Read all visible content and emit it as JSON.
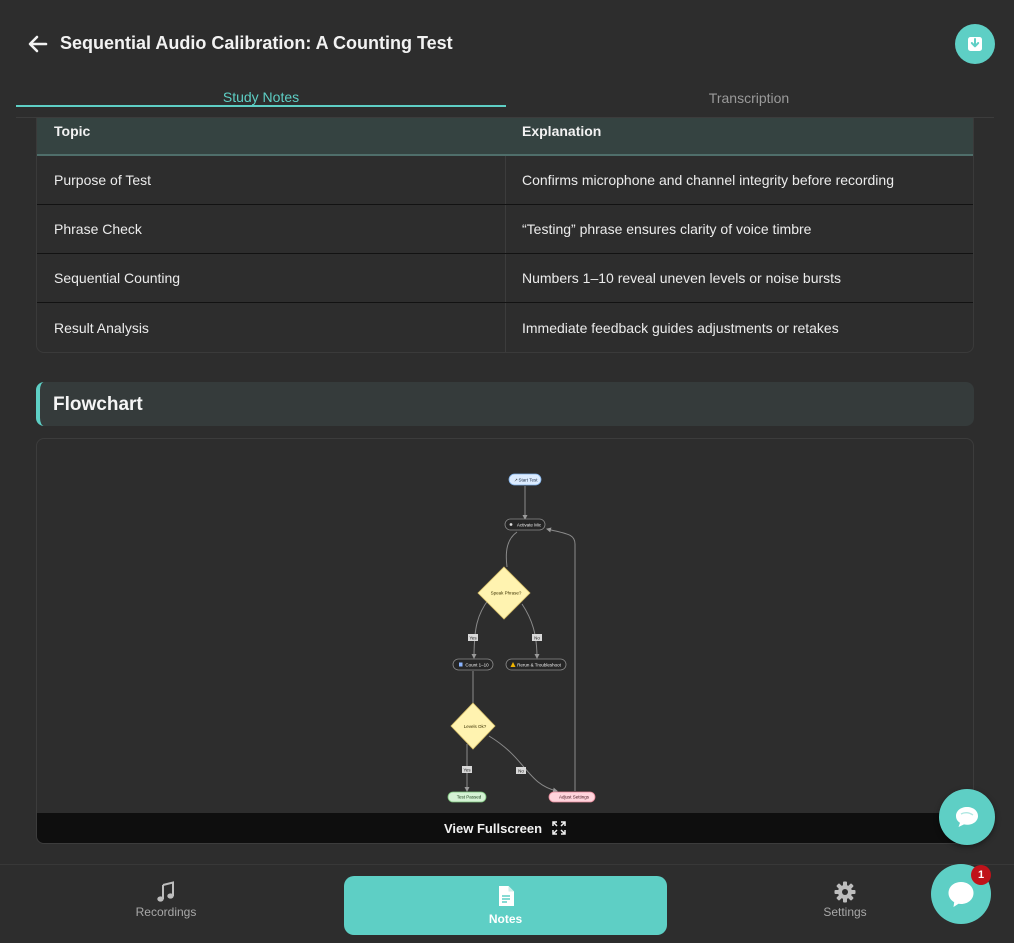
{
  "header": {
    "title": "Sequential Audio Calibration: A Counting Test",
    "back_icon": "arrow-left-icon",
    "download_icon": "download-icon",
    "accent_color": "#5ecfc5"
  },
  "tabs": [
    {
      "label": "Study Notes",
      "active": true
    },
    {
      "label": "Transcription",
      "active": false
    }
  ],
  "table": {
    "headers": [
      "Topic",
      "Explanation"
    ],
    "rows": [
      [
        "Purpose of Test",
        "Confirms microphone and channel integrity before recording"
      ],
      [
        "Phrase Check",
        "“Testing” phrase ensures clarity of voice timbre"
      ],
      [
        "Sequential Counting",
        "Numbers 1–10 reveal uneven levels or noise bursts"
      ],
      [
        "Result Analysis",
        "Immediate feedback guides adjustments or retakes"
      ]
    ]
  },
  "flowchart": {
    "title": "Flowchart",
    "nodes": {
      "start": "Start Test",
      "activate": "Activate Mic",
      "speak": "Speak Phrase?",
      "count": "Count 1–10",
      "rerun": "Rerun & Troubleshoot",
      "levels": "Levels Ok?",
      "passed": "Test Passed",
      "adjust": "Adjust Settings"
    },
    "edges": {
      "yes1": "Yes",
      "no1": "No",
      "yes2": "Yes",
      "no2": "No"
    },
    "fullscreen_label": "View Fullscreen",
    "fullscreen_icon": "expand-icon"
  },
  "chat": {
    "icon": "chat-bubble-icon"
  },
  "nav": {
    "recordings": "Recordings",
    "notes": "Notes",
    "settings": "Settings"
  },
  "messenger": {
    "badge": "1",
    "icon": "messenger-icon"
  }
}
